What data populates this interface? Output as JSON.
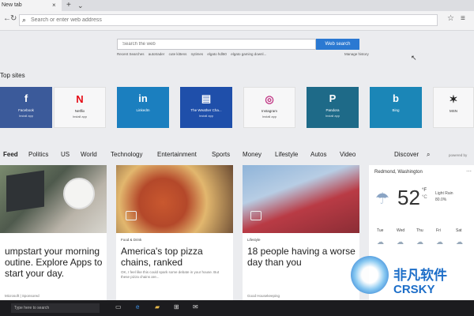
{
  "browser": {
    "tab_title": "New tab",
    "tab_close": "×",
    "new_tab": "+",
    "tab_chevron": "⌄",
    "address_placeholder": "Search or enter web address"
  },
  "search": {
    "placeholder": "Search the web",
    "button": "Web search",
    "recent_label": "Recent Searches",
    "recent": [
      "autotrader",
      "cute kittens",
      "nytimes",
      "elgato hdl60",
      "elgato gaming downl..."
    ],
    "manage": "Manage history"
  },
  "top_sites": {
    "title": "Top sites",
    "tiles": [
      {
        "icon": "f",
        "name": "Facebook",
        "install": "Install app",
        "color": "#3b5a9a"
      },
      {
        "icon": "N",
        "name": "Netflix",
        "install": "Install app",
        "color": "#f7f7f8"
      },
      {
        "icon": "in",
        "name": "LinkedIn",
        "install": "",
        "color": "#1b7fbf"
      },
      {
        "icon": "▤",
        "name": "The Weather Cha...",
        "install": "Install app",
        "color": "#1f4faa"
      },
      {
        "icon": "◎",
        "name": "Instagram",
        "install": "Install app",
        "color": "#f7f7f8"
      },
      {
        "icon": "P",
        "name": "Pandora",
        "install": "Install app",
        "color": "#1e6a88"
      },
      {
        "icon": "b",
        "name": "Bing",
        "install": "",
        "color": "#1b86b7"
      },
      {
        "icon": "✶",
        "name": "MSN",
        "install": "",
        "color": "#f7f7f8"
      }
    ]
  },
  "feed_nav": {
    "items": [
      "Feed",
      "Politics",
      "US",
      "World",
      "Technology",
      "Entertainment",
      "Sports",
      "Money",
      "Lifestyle",
      "Autos",
      "Video"
    ],
    "discover": "Discover",
    "powered": "powered by"
  },
  "cards": [
    {
      "category": "",
      "title_lines": [
        "umpstart your morning",
        "outine. Explore Apps to",
        "start your day."
      ],
      "desc": "",
      "source": "Microsoft | Sponsored"
    },
    {
      "category": "Food & Drink",
      "title_lines": [
        "America's top pizza",
        "chains, ranked"
      ],
      "desc": "OK, I feel like this could spark some debate in your house. But these pizza chains are...",
      "source": ""
    },
    {
      "category": "Lifestyle",
      "title_lines": [
        "18 people having a worse",
        "day than you"
      ],
      "desc": "",
      "source": "Good Housekeeping"
    }
  ],
  "weather": {
    "location": "Redmond, Washington",
    "temp": "52",
    "unit": "°F",
    "unit_alt": "°C",
    "condition": "Light Rain",
    "precip": "80.0%",
    "days": [
      "Tue",
      "Wed",
      "Thu",
      "Fri",
      "Sat"
    ]
  },
  "taskbar": {
    "search_placeholder": "Type here to search"
  },
  "watermark": {
    "cn": "非凡软件",
    "en": "CRSKY"
  }
}
